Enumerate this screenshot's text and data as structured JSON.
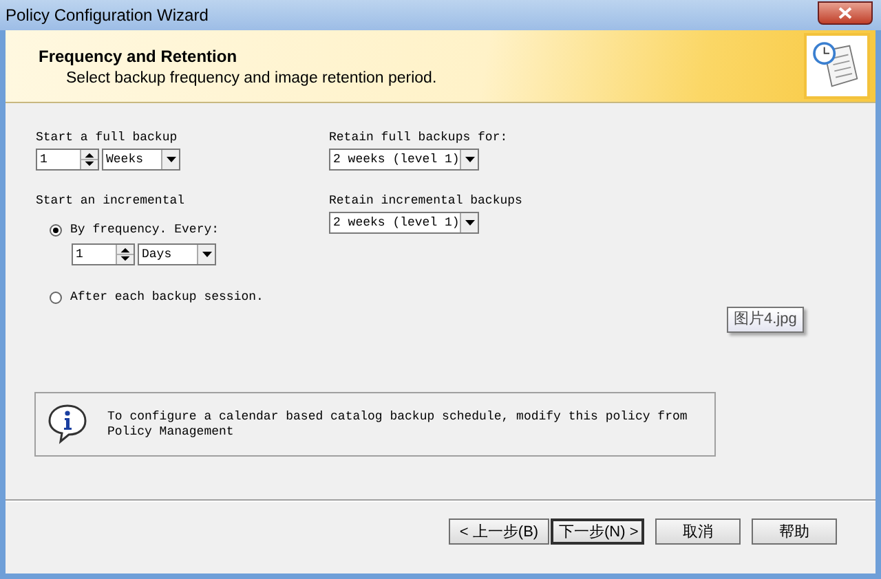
{
  "window": {
    "title": "Policy Configuration Wizard"
  },
  "header": {
    "title": "Frequency and Retention",
    "subtitle": "Select backup frequency and image retention period."
  },
  "full_backup": {
    "label": "Start a full backup",
    "value": "1",
    "unit": "Weeks"
  },
  "incremental": {
    "label": "Start an incremental",
    "value": "1",
    "unit": "Days",
    "options": [
      {
        "label": "By frequency. Every:",
        "selected": true
      },
      {
        "label": "After each backup session.",
        "selected": false
      }
    ]
  },
  "retain_full": {
    "label": "Retain full backups for:",
    "value": "2 weeks (level 1)"
  },
  "retain_incremental": {
    "label": "Retain incremental backups",
    "value": "2 weeks (level 1)"
  },
  "info": {
    "text": "To configure a calendar based catalog backup schedule, modify this policy from Policy Management"
  },
  "tooltip": {
    "text": "图片4.jpg"
  },
  "buttons": [
    {
      "label": "< 上一步(B)",
      "default": false
    },
    {
      "label": "下一步(N) >",
      "default": true
    },
    {
      "label": "取消",
      "default": false
    },
    {
      "label": "帮助",
      "default": false
    }
  ]
}
